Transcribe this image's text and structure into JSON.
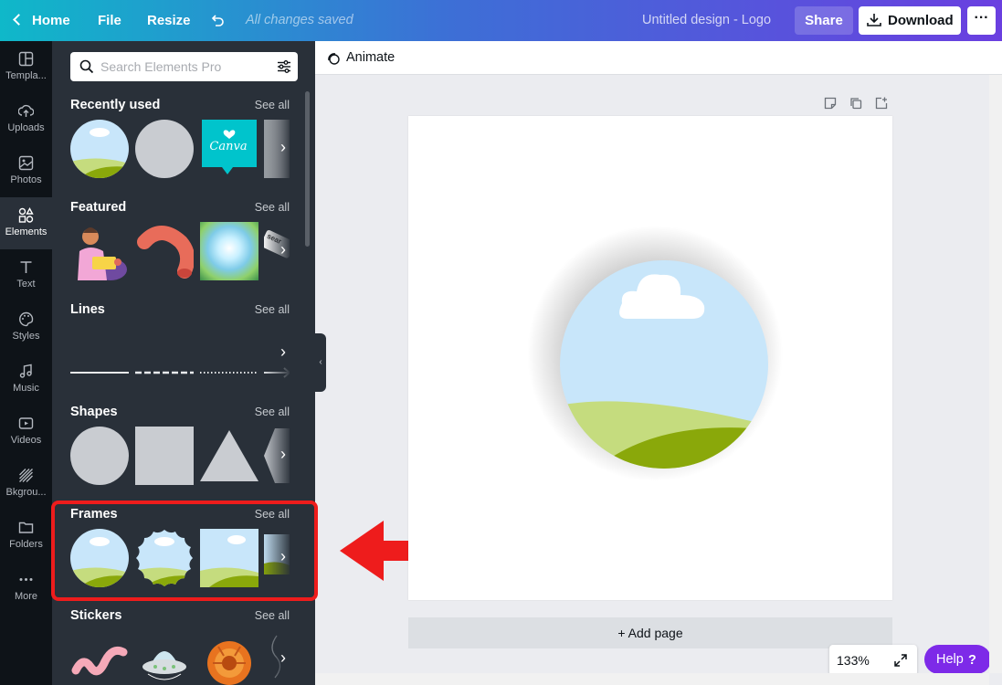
{
  "topbar": {
    "home": "Home",
    "file": "File",
    "resize": "Resize",
    "undo_icon": "undo-icon",
    "saved_status": "All changes saved",
    "design_title": "Untitled design - Logo",
    "share": "Share",
    "download": "Download",
    "more": "···"
  },
  "rail": [
    {
      "label": "Templa...",
      "icon": "templates-icon"
    },
    {
      "label": "Uploads",
      "icon": "upload-icon"
    },
    {
      "label": "Photos",
      "icon": "photo-icon"
    },
    {
      "label": "Elements",
      "icon": "shapes-icon",
      "active": true
    },
    {
      "label": "Text",
      "icon": "text-icon"
    },
    {
      "label": "Styles",
      "icon": "palette-icon"
    },
    {
      "label": "Music",
      "icon": "music-icon"
    },
    {
      "label": "Videos",
      "icon": "video-icon"
    },
    {
      "label": "Bkgrou...",
      "icon": "background-icon"
    },
    {
      "label": "Folders",
      "icon": "folder-icon"
    },
    {
      "label": "More",
      "icon": "more-dots-icon"
    }
  ],
  "panel": {
    "search_placeholder": "Search Elements Pro",
    "see_all": "See all",
    "sections": {
      "recently_used": "Recently used",
      "featured": "Featured",
      "lines": "Lines",
      "shapes": "Shapes",
      "frames": "Frames",
      "stickers": "Stickers"
    },
    "canva_sticker_text": "Canva",
    "featured_tag_text": "sear"
  },
  "editor": {
    "animate": "Animate",
    "add_page": "+ Add page",
    "zoom": "133%",
    "help": "Help",
    "help_q": "?"
  },
  "colors": {
    "accent_purple": "#7d2ae8",
    "panel_bg": "#293039",
    "rail_bg": "#0e1318",
    "highlight_red": "#ee1c1c",
    "sky": "#c8e6fa",
    "grass_light": "#c5dc7e",
    "grass_dark": "#8aa80a"
  }
}
